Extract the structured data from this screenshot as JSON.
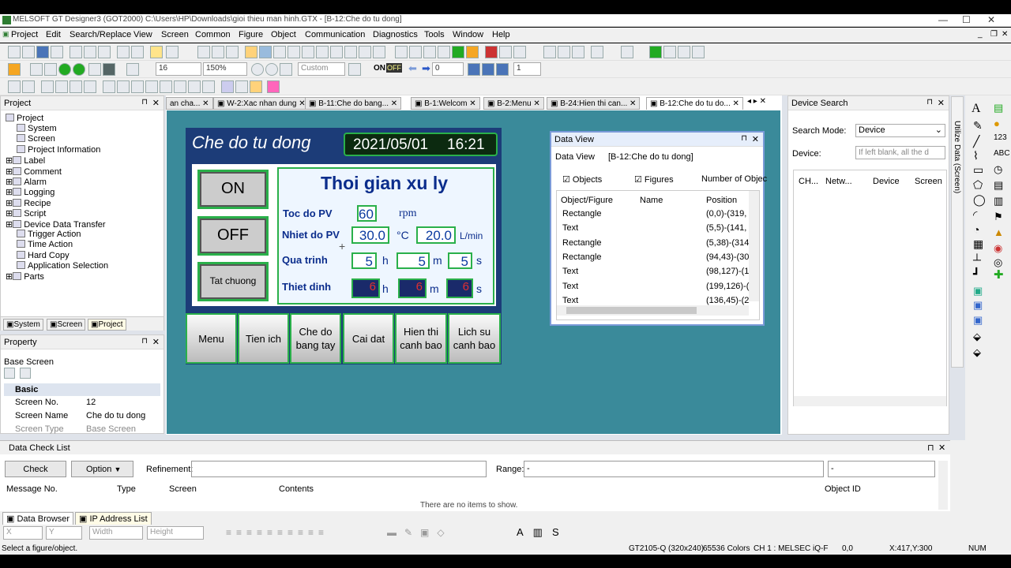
{
  "window": {
    "title": "MELSOFT GT Designer3 (GOT2000) C:\\Users\\HP\\Downloads\\gioi thieu man hinh.GTX - [B-12:Che do tu dong]"
  },
  "menu": [
    "Project",
    "Edit",
    "Search/Replace",
    "View",
    "Screen",
    "Common",
    "Figure",
    "Object",
    "Communication",
    "Diagnostics",
    "Tools",
    "Window",
    "Help"
  ],
  "toolbar": {
    "font_size": "16",
    "zoom": "150%",
    "custom": "Custom",
    "on": "ON",
    "off": "OFF",
    "value0": "0",
    "value1": "1"
  },
  "project_panel": {
    "title": "Project",
    "items": [
      "Project",
      "System",
      "Screen",
      "Project Information",
      "Label",
      "Comment",
      "Alarm",
      "Logging",
      "Recipe",
      "Script",
      "Device Data Transfer",
      "Trigger Action",
      "Time Action",
      "Hard Copy",
      "Application Selection",
      "Parts"
    ],
    "tabs": [
      "System",
      "Screen",
      "Project"
    ]
  },
  "property_panel": {
    "title": "Property",
    "subtitle": "Base Screen",
    "section": "Basic",
    "rows": [
      {
        "k": "Screen No.",
        "v": "12"
      },
      {
        "k": "Screen Name",
        "v": "Che do tu dong"
      },
      {
        "k": "Screen Type",
        "v": "Base Screen"
      }
    ]
  },
  "tabs": [
    "an cha...",
    "W-2:Xac nhan dung",
    "B-11:Che do bang...",
    "B-1:Welcom",
    "B-2:Menu",
    "B-24:Hien thi can...",
    "B-12:Che do tu do..."
  ],
  "hmi": {
    "header": "Che do tu dong",
    "date": "2021/05/01",
    "time": "16:21",
    "title": "Thoi gian xu ly",
    "btn_on": "ON",
    "btn_off": "OFF",
    "btn_tat": "Tat chuong",
    "lbl_toc": "Toc do PV",
    "val_toc": "60",
    "unit_rpm": "rpm",
    "lbl_nhiet": "Nhiet do PV",
    "val_nhiet": "30.0",
    "unit_c": "°C",
    "val_lmin": "20.0",
    "unit_lmin": "L/min",
    "lbl_qua": "Qua trinh",
    "val_q1": "5",
    "val_q2": "5",
    "val_q3": "5",
    "u_h": "h",
    "u_m": "m",
    "u_s": "s",
    "lbl_thiet": "Thiet dinh",
    "val_t1": "6",
    "val_t2": "6",
    "val_t3": "6",
    "nav": [
      "Menu",
      "Tien ich",
      "Che do\nbang tay",
      "Cai dat",
      "Hien thi\ncanh bao",
      "Lich su\ncanh bao"
    ]
  },
  "data_view": {
    "title": "Data View",
    "label": "Data View",
    "screen": "[B-12:Che do tu dong]",
    "chk_objects": "Objects",
    "chk_figures": "Figures",
    "num_obj": "Number of Objec",
    "cols": [
      "Object/Figure",
      "Name",
      "Position"
    ],
    "rows": [
      {
        "t": "Rectangle",
        "p": "(0,0)-(319,"
      },
      {
        "t": "Text",
        "p": "(5,5)-(141,"
      },
      {
        "t": "Rectangle",
        "p": "(5,38)-(314"
      },
      {
        "t": "Rectangle",
        "p": "(94,43)-(30"
      },
      {
        "t": "Text",
        "p": "(98,127)-(1"
      },
      {
        "t": "Text",
        "p": "(199,126)-("
      },
      {
        "t": "Text",
        "p": "(136,45)-(2"
      }
    ]
  },
  "device_search": {
    "title": "Device Search",
    "mode_label": "Search Mode:",
    "mode": "Device",
    "device_label": "Device:",
    "device_ph": "If left blank, all the d",
    "cols": [
      "CH...",
      "Netw...",
      "Device",
      "Screen"
    ]
  },
  "utilize": "Utilize Data (Screen)",
  "check_list": {
    "title": "Data Check List",
    "check": "Check",
    "option": "Option",
    "refinement": "Refinement:",
    "range": "Range:",
    "range_val": "-",
    "range_val2": "-",
    "cols": [
      "Message No.",
      "Type",
      "Screen",
      "Contents",
      "Object ID"
    ],
    "empty": "There are no items to show."
  },
  "bottom_tabs": [
    "Data Browser",
    "IP Address List"
  ],
  "fmt": {
    "x": "X",
    "y": "Y",
    "width": "Width",
    "height": "Height"
  },
  "status": {
    "msg": "Select a figure/object.",
    "model": "GT2105-Q (320x240)",
    "colors": "65536 Colors",
    "ch": "CH 1 : MELSEC iQ-F",
    "coord0": "0,0",
    "xy": "X:417,Y:300",
    "num": "NUM"
  }
}
